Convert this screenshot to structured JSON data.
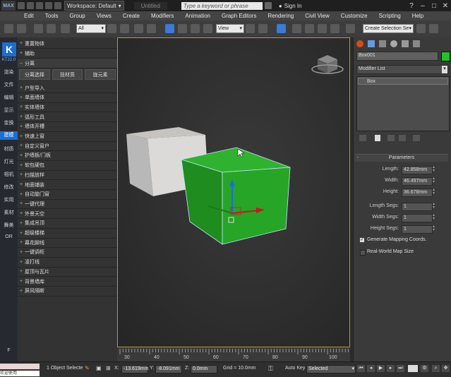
{
  "titlebar": {
    "app_logo": "MAX",
    "workspace_label": "Workspace: Default",
    "document_title": "Untitled",
    "search_placeholder": "Type a keyword or phrase",
    "sign_in": "Sign In"
  },
  "menu": [
    "Edit",
    "Tools",
    "Group",
    "Views",
    "Create",
    "Modifiers",
    "Animation",
    "Graph Editors",
    "Rendering",
    "Civil View",
    "Customize",
    "Scripting",
    "Help"
  ],
  "toolbar": {
    "filter_value": "All",
    "coord_value": "View",
    "selection_set": "Create Selection Se"
  },
  "kstrip": {
    "badge": "K",
    "version": "KT22.0",
    "items": [
      "渲染",
      "文件",
      "编辑",
      "显示",
      "变换",
      "建模",
      "材质",
      "灯光",
      "相机",
      "修改",
      "实用",
      "素材",
      "舞美",
      "OR"
    ],
    "footer": "F"
  },
  "plugin": {
    "top_rows": [
      "重置物体",
      "辅助",
      "分离"
    ],
    "tabs": [
      "分离选择",
      "技材质",
      "拢元素"
    ],
    "rows": [
      "户型导入",
      "单面墙体",
      "实体墙体",
      "弧形工具",
      "墙体开槽",
      "快速上窗",
      "自定义窗户",
      "护墙板/门板",
      "软包硬包",
      "扫描放样",
      "地面铺装",
      "自动旋门窗",
      "一键代理",
      "外景天空",
      "集成吊顶",
      "超级楼梯",
      "幕花脚线",
      "一键调柜",
      "凌打线",
      "屋顶与瓦片",
      "背景墙库",
      "屏风隔断"
    ]
  },
  "viewport": {
    "timeline_ticks": [
      "30",
      "40",
      "50",
      "60",
      "70",
      "80",
      "90",
      "100"
    ]
  },
  "command_panel": {
    "object_name": "Box001",
    "object_color": "#22c32a",
    "modifier_list_label": "Modifier List",
    "stack_item": "Box",
    "parameters_title": "Parameters",
    "params": [
      {
        "label": "Length:",
        "value": "42.858mm"
      },
      {
        "label": "Width:",
        "value": "46.497mm"
      },
      {
        "label": "Height:",
        "value": "36.678mm"
      }
    ],
    "segs": [
      {
        "label": "Length Segs:",
        "value": "1"
      },
      {
        "label": "Width Segs:",
        "value": "1"
      },
      {
        "label": "Height Segs:",
        "value": "1"
      }
    ],
    "checkboxes": [
      {
        "label": "Generate Mapping Coords.",
        "checked": true
      },
      {
        "label": "Real-World Map Size",
        "checked": false
      }
    ]
  },
  "statusbar": {
    "script_listener": "欢迎使用",
    "selection_status": "1 Object Selecte",
    "x_value": "-13.619mm",
    "y_value": "-8.091mm",
    "z_value": "0.0mm",
    "grid": "Grid = 10.0mm",
    "auto_key": "Auto Key",
    "selected_dd": "Selected",
    "x_label": "X:",
    "y_label": "Y:",
    "z_label": "Z:"
  }
}
